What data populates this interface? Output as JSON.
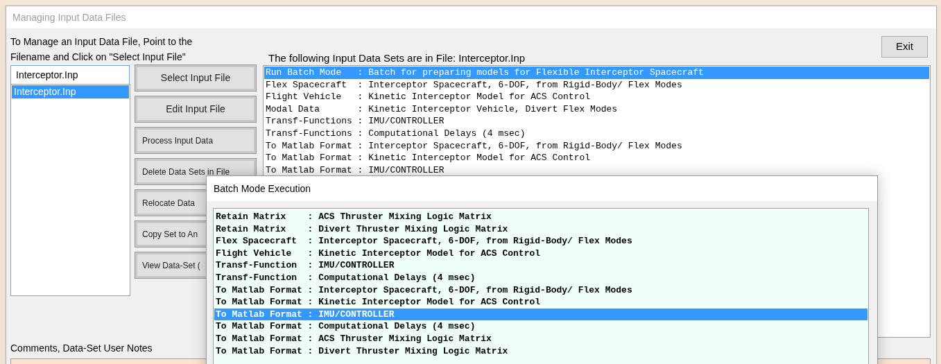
{
  "window": {
    "title": "Managing Input Data Files"
  },
  "instructions": [
    "To Manage an Input Data File, Point to the",
    "Filename and Click on \"Select Input File\""
  ],
  "filename_field": {
    "value": "Interceptor.Inp"
  },
  "files": [
    {
      "name": "Interceptor.Inp",
      "selected": true
    }
  ],
  "buttons": [
    "Select Input File",
    "Edit Input File",
    "Process Input Data",
    "Delete Data Sets in File",
    "Relocate Data",
    "Copy Set to An",
    "View Data-Set ("
  ],
  "exit_button": "Exit",
  "data_sets_label": "The following Input Data Sets are in File: Interceptor.Inp",
  "data_sets": [
    {
      "text": "Run Batch Mode   : Batch for preparing models for Flexible Interceptor Spacecraft",
      "selected": true
    },
    {
      "text": "Flex Spacecraft  : Interceptor Spacecraft, 6-DOF, from Rigid-Body/ Flex Modes",
      "selected": false
    },
    {
      "text": "Flight Vehicle   : Kinetic Interceptor Model for ACS Control",
      "selected": false
    },
    {
      "text": "Modal Data       : Kinetic Interceptor Vehicle, Divert Flex Modes",
      "selected": false
    },
    {
      "text": "Transf-Functions : IMU/CONTROLLER",
      "selected": false
    },
    {
      "text": "Transf-Functions : Computational Delays (4 msec)",
      "selected": false
    },
    {
      "text": "To Matlab Format : Interceptor Spacecraft, 6-DOF, from Rigid-Body/ Flex Modes",
      "selected": false
    },
    {
      "text": "To Matlab Format : Kinetic Interceptor Model for ACS Control",
      "selected": false
    },
    {
      "text": "To Matlab Format : IMU/CONTROLLER",
      "selected": false
    }
  ],
  "comments_label": "Comments, Data-Set User Notes",
  "dialog": {
    "title": "Batch Mode Execution",
    "items": [
      {
        "text": "Retain Matrix    : ACS Thruster Mixing Logic Matrix",
        "selected": false
      },
      {
        "text": "Retain Matrix    : Divert Thruster Mixing Logic Matrix",
        "selected": false
      },
      {
        "text": "Flex Spacecraft  : Interceptor Spacecraft, 6-DOF, from Rigid-Body/ Flex Modes",
        "selected": false
      },
      {
        "text": "Flight Vehicle   : Kinetic Interceptor Model for ACS Control",
        "selected": false
      },
      {
        "text": "Transf-Function  : IMU/CONTROLLER",
        "selected": false
      },
      {
        "text": "Transf-Function  : Computational Delays (4 msec)",
        "selected": false
      },
      {
        "text": "To Matlab Format : Interceptor Spacecraft, 6-DOF, from Rigid-Body/ Flex Modes",
        "selected": false
      },
      {
        "text": "To Matlab Format : Kinetic Interceptor Model for ACS Control",
        "selected": false
      },
      {
        "text": "To Matlab Format : IMU/CONTROLLER",
        "selected": true
      },
      {
        "text": "To Matlab Format : Computational Delays (4 msec)",
        "selected": false
      },
      {
        "text": "To Matlab Format : ACS Thruster Mixing Logic Matrix",
        "selected": false
      },
      {
        "text": "To Matlab Format : Divert Thruster Mixing Logic Matrix",
        "selected": false
      }
    ]
  }
}
